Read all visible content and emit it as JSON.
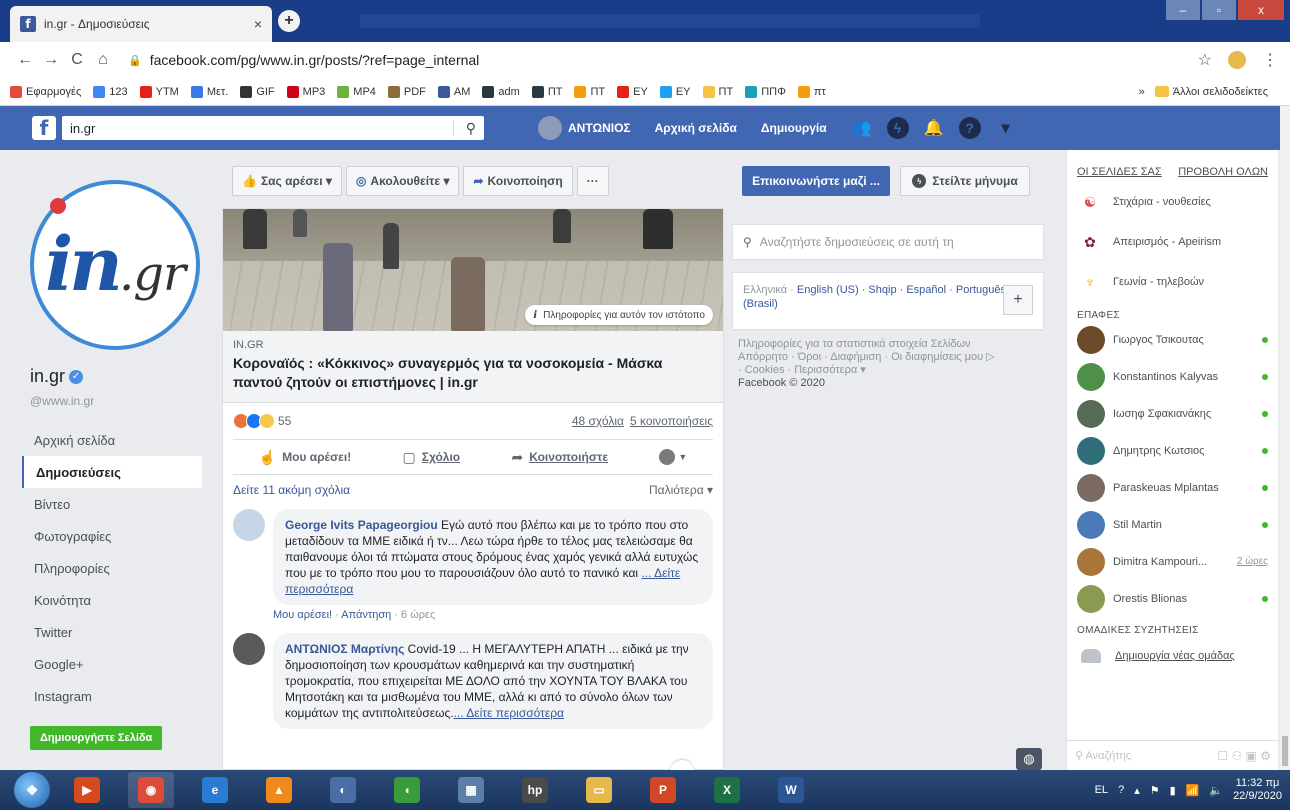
{
  "browser": {
    "tab_title": "in.gr - Δημοσιεύσεις",
    "tab_close": "×",
    "new_tab": "+",
    "url": "facebook.com/pg/www.in.gr/posts/?ref=page_internal",
    "back": "←",
    "forward": "→",
    "reload": "C",
    "home": "⌂",
    "star": "☆",
    "menu": "⋮",
    "window_controls": {
      "minimize": "–",
      "maximize": "▫",
      "close": "x"
    }
  },
  "bookmarks": {
    "items": [
      {
        "label": "Εφαρμογές",
        "color": "#e34c3b"
      },
      {
        "label": "123",
        "color": "#4285f4"
      },
      {
        "label": "YTM",
        "color": "#e62117"
      },
      {
        "label": "Μετ.",
        "color": "#3b78e7"
      },
      {
        "label": "GIF",
        "color": "#333333"
      },
      {
        "label": "MP3",
        "color": "#d0021b"
      },
      {
        "label": "MP4",
        "color": "#6cb33f"
      },
      {
        "label": "PDF",
        "color": "#8a6d3b"
      },
      {
        "label": "AM",
        "color": "#3b5998"
      },
      {
        "label": "adm",
        "color": "#2b3a42"
      },
      {
        "label": "ΠΤ",
        "color": "#2b3a42"
      },
      {
        "label": "ΠΤ",
        "color": "#f39c12"
      },
      {
        "label": "EY",
        "color": "#e62117"
      },
      {
        "label": "EY",
        "color": "#1da1f2"
      },
      {
        "label": "ΠΤ",
        "color": "#f4c542"
      },
      {
        "label": "ΠΠΦ",
        "color": "#17a2b8"
      },
      {
        "label": "πτ",
        "color": "#f39c12"
      }
    ],
    "overflow": "»",
    "other_folder": "Άλλοι σελιδοδείκτες"
  },
  "fb_bar": {
    "logo": "f",
    "search_value": "in.gr",
    "search_icon": "⚲",
    "user_name": "ΑΝΤΩΝΙΟΣ",
    "home": "Αρχική σελίδα",
    "create": "Δημιουργία",
    "help": "?",
    "caret": "▾"
  },
  "page": {
    "logo_main": "in",
    "logo_suffix": ".gr",
    "name": "in.gr",
    "handle": "@www.in.gr",
    "verified": "✓",
    "nav": [
      {
        "label": "Αρχική σελίδα",
        "active": false
      },
      {
        "label": "Δημοσιεύσεις",
        "active": true
      },
      {
        "label": "Βίντεο",
        "active": false
      },
      {
        "label": "Φωτογραφίες",
        "active": false
      },
      {
        "label": "Πληροφορίες",
        "active": false
      },
      {
        "label": "Κοινότητα",
        "active": false
      },
      {
        "label": "Twitter",
        "active": false
      },
      {
        "label": "Google+",
        "active": false
      },
      {
        "label": "Instagram",
        "active": false
      }
    ],
    "create_page": "Δημιουργήστε Σελίδα"
  },
  "page_actions": {
    "like": "Σας αρέσει ▾",
    "follow": "Ακολουθείτε ▾",
    "share": "Κοινοποίηση",
    "more": "···",
    "contact": "Επικοινωνήστε μαζί ...",
    "message": "Στείλτε μήνυμα"
  },
  "post": {
    "info_tag": "Πληροφορίες για αυτόν τον ιστότοπο",
    "info_i": "i",
    "domain": "IN.GR",
    "title": "Κοροναϊός : «Κόκκινος» συναγερμός για τα νοσοκομεία - Μάσκα παντού ζητούν οι επιστήμονες | in.gr",
    "reactions_count": "55",
    "comments_count": "48 σχόλια",
    "shares_count": "5 κοινοποιήσεις",
    "like_btn": "Μου αρέσει!",
    "comment_btn": "Σχόλιο",
    "share_btn": "Κοινοποιήστε",
    "more_comments": "Δείτε 11 ακόμη σχόλια",
    "order": "Παλιότερα ▾"
  },
  "comments": [
    {
      "author": "George Ivits Papageorgiou",
      "text": " Εγώ αυτό που βλέπω και με το τρόπο που στο μεταδίδουν τα ΜΜΕ ειδικά ή τν... Λεω τώρα ήρθε το τέλος μας τελειώσαμε θα παιθανουμε όλοι τά πτώματα στους δρόμους ένας χαμός γενικά αλλά ευτυχώς που με το τρόπο που μου το παρουσιάζουν όλο αυτό το πανικό και ",
      "see_more": "... Δείτε περισσότερα",
      "like": "Μου αρέσει!",
      "reply": "Απάντηση",
      "time": "6 ώρες",
      "avatar_color": "#c7d6e6"
    },
    {
      "author": "ΑΝΤΩΝΙΟΣ Μαρτίνης",
      "text": " Covid-19 ... Η ΜΕΓΑΛΥΤΕΡΗ ΑΠΑΤΗ ... ειδικά με την δημοσιοποίηση των κρουσμάτων καθημερινά και την συστηματική τρομοκρατία, που επιχειρείται ΜΕ ΔΟΛΟ από την ΧΟΥΝΤΑ ΤΟΥ ΒΛΑΚΑ του Μητσοτάκη και τα μισθωμένα του ΜΜΕ, αλλά κι από το σύνολο όλων των κομμάτων της αντιπολιτεύσεως.",
      "see_more": "... Δείτε περισσότερα",
      "avatar_color": "#5a5a5a"
    }
  ],
  "middle": {
    "search_placeholder": "Αναζητήστε δημοσιεύσεις σε αυτή τη",
    "languages_current": "Ελληνικά",
    "languages": "English (US) · Shqip · Español · Português (Brasil)",
    "lang_plus": "+",
    "footer_lines": [
      "Πληροφορίες για τα στατιστικά στοιχεία Σελίδων",
      "Απόρρητο · Όροι · Διαφήμιση · Οι διαφημίσεις μου ▷",
      "· Cookies · Περισσότερα ▾"
    ],
    "copyright": "Facebook © 2020"
  },
  "right": {
    "your_pages": "ΟΙ ΣΕΛΙΔΕΣ ΣΑΣ",
    "view_all": "ΠΡΟΒΟΛΗ ΟΛΩΝ",
    "pages": [
      {
        "name": "Στιχάρια - νουθεσίες",
        "color": "#d9534f",
        "glyph": "☯"
      },
      {
        "name": "Απειρισμός - Apeirism",
        "color": "#8b1a3e",
        "glyph": "✿"
      },
      {
        "name": "Γεωνία - τηλεβοών",
        "color": "#f0a830",
        "glyph": "♆"
      }
    ],
    "contacts_title": "ΕΠΑΦΕΣ",
    "contacts": [
      {
        "name": "Γιωργος Τσικουτας",
        "online": true,
        "ago": "",
        "color": "#6b4a2a"
      },
      {
        "name": "Konstantinos Kalyvas",
        "online": true,
        "ago": "",
        "color": "#4e8f4a"
      },
      {
        "name": "Ιωσηφ Σφακιανάκης",
        "online": true,
        "ago": "",
        "color": "#556b55"
      },
      {
        "name": "Δημητρης Κωτσιος",
        "online": true,
        "ago": "",
        "color": "#2f6f7a"
      },
      {
        "name": "Paraskeuas Mplantas",
        "online": true,
        "ago": "",
        "color": "#7a6a60"
      },
      {
        "name": "Stil Martin",
        "online": true,
        "ago": "",
        "color": "#4a7ab8"
      },
      {
        "name": "Dimitra Kampouri...",
        "online": false,
        "ago": "2 ώρες",
        "color": "#a8763a"
      },
      {
        "name": "Orestis Blionas",
        "online": true,
        "ago": "",
        "color": "#8a9a50"
      }
    ],
    "groups_title": "ΟΜΑΔΙΚΕΣ ΣΥΖΗΤΗΣΕΙΣ",
    "new_group": "Δημιουργία νέας ομάδας",
    "chat_search": "⚲ Αναζήτης",
    "chat_icons": "☐ ⚇ ▣ ⚙"
  },
  "taskbar": {
    "start": "❖",
    "apps": [
      {
        "name": "media",
        "color": "#d64a1e",
        "glyph": "▶"
      },
      {
        "name": "chrome",
        "color": "#dd4b39",
        "glyph": "◉"
      },
      {
        "name": "ie",
        "color": "#2a7bd3",
        "glyph": "e"
      },
      {
        "name": "vlc",
        "color": "#f08a1c",
        "glyph": "▲"
      },
      {
        "name": "app-globe",
        "color": "#4a6da8",
        "glyph": "◐"
      },
      {
        "name": "app-green",
        "color": "#3a9b3a",
        "glyph": "◖"
      },
      {
        "name": "calculator",
        "color": "#5b7fa6",
        "glyph": "▦"
      },
      {
        "name": "hp",
        "color": "#4a4a4a",
        "glyph": "hp"
      },
      {
        "name": "explorer",
        "color": "#e7b84a",
        "glyph": "▭"
      },
      {
        "name": "powerpoint",
        "color": "#d24726",
        "glyph": "P"
      },
      {
        "name": "excel",
        "color": "#1e7145",
        "glyph": "X"
      },
      {
        "name": "word",
        "color": "#2b5797",
        "glyph": "W"
      }
    ],
    "lang": "EL",
    "time": "11:32 πμ",
    "date": "22/9/2020"
  }
}
